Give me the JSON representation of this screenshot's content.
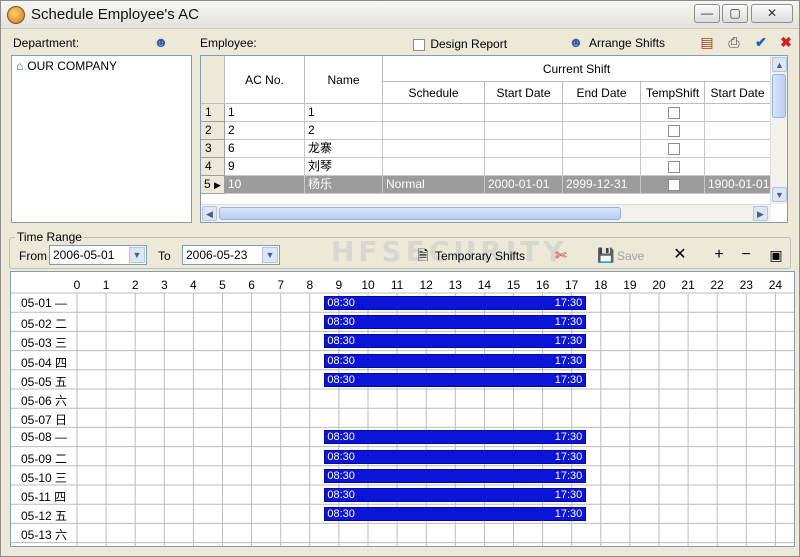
{
  "window": {
    "title": "Schedule Employee's AC",
    "minimize": "—",
    "maximize": "▢",
    "close": "✕"
  },
  "department": {
    "label": "Department:",
    "tree": [
      {
        "label": "OUR COMPANY"
      }
    ]
  },
  "employee": {
    "label": "Employee:"
  },
  "toolbar_top": {
    "design_report": "Design Report",
    "arrange_shifts": "Arrange Shifts"
  },
  "grid": {
    "group_header": "Current Shift",
    "columns": [
      "AC No.",
      "Name",
      "Schedule",
      "Start Date",
      "End Date",
      "TempShift",
      "Start Date"
    ],
    "rows": [
      {
        "num": "1",
        "ac": "1",
        "name": "1",
        "schedule": "",
        "start": "",
        "end": "",
        "tstart": ""
      },
      {
        "num": "2",
        "ac": "2",
        "name": "2",
        "schedule": "",
        "start": "",
        "end": "",
        "tstart": ""
      },
      {
        "num": "3",
        "ac": "6",
        "name": "龙寨",
        "schedule": "",
        "start": "",
        "end": "",
        "tstart": ""
      },
      {
        "num": "4",
        "ac": "9",
        "name": "刘琴",
        "schedule": "",
        "start": "",
        "end": "",
        "tstart": ""
      },
      {
        "num": "5",
        "ac": "10",
        "name": "杨乐",
        "schedule": "Normal",
        "start": "2000-01-01",
        "end": "2999-12-31",
        "tstart": "1900-01-01"
      }
    ]
  },
  "time_range": {
    "title": "Time Range",
    "from_label": "From",
    "from_value": "2006-05-01",
    "to_label": "To",
    "to_value": "2006-05-23",
    "temporary_shifts": "Temporary Shifts",
    "save": "Save",
    "watermark": "HFSECURITY"
  },
  "timetable": {
    "hours": [
      "0",
      "1",
      "2",
      "3",
      "4",
      "5",
      "6",
      "7",
      "8",
      "9",
      "10",
      "11",
      "12",
      "13",
      "14",
      "15",
      "16",
      "17",
      "18",
      "19",
      "20",
      "21",
      "22",
      "23",
      "24"
    ],
    "days": [
      {
        "label": "05-01 —",
        "shift": true,
        "start": "08:30",
        "end": "17:30"
      },
      {
        "label": "05-02 二",
        "shift": true,
        "start": "08:30",
        "end": "17:30"
      },
      {
        "label": "05-03 三",
        "shift": true,
        "start": "08:30",
        "end": "17:30"
      },
      {
        "label": "05-04 四",
        "shift": true,
        "start": "08:30",
        "end": "17:30"
      },
      {
        "label": "05-05 五",
        "shift": true,
        "start": "08:30",
        "end": "17:30"
      },
      {
        "label": "05-06 六",
        "shift": false,
        "start": "",
        "end": ""
      },
      {
        "label": "05-07 日",
        "shift": false,
        "start": "",
        "end": ""
      },
      {
        "label": "05-08 —",
        "shift": true,
        "start": "08:30",
        "end": "17:30"
      },
      {
        "label": "05-09 二",
        "shift": true,
        "start": "08:30",
        "end": "17:30"
      },
      {
        "label": "05-10 三",
        "shift": true,
        "start": "08:30",
        "end": "17:30"
      },
      {
        "label": "05-11 四",
        "shift": true,
        "start": "08:30",
        "end": "17:30"
      },
      {
        "label": "05-12 五",
        "shift": true,
        "start": "08:30",
        "end": "17:30"
      },
      {
        "label": "05-13 六",
        "shift": false,
        "start": "",
        "end": ""
      }
    ]
  },
  "colors": {
    "shift_bar": "#0b14d8",
    "selected_row": "#9c9c9c"
  }
}
